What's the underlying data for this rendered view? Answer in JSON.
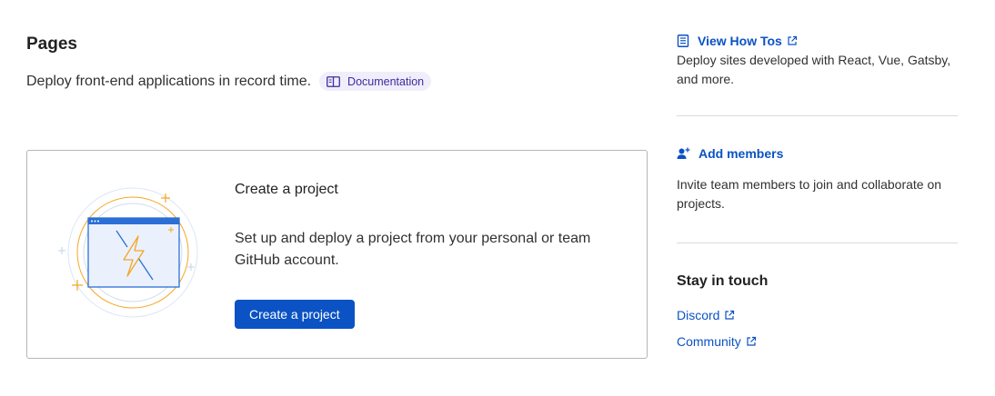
{
  "header": {
    "title": "Pages",
    "subtitle": "Deploy front-end applications in record time.",
    "doc_badge": "Documentation"
  },
  "card": {
    "title": "Create a project",
    "description": "Set up and deploy a project from your personal or team GitHub account.",
    "button": "Create a project"
  },
  "sidebar": {
    "how_tos": {
      "link": "View How Tos",
      "text": "Deploy sites developed with React, Vue, Gatsby, and more."
    },
    "members": {
      "link": "Add members",
      "text": "Invite team members to join and collaborate on projects."
    },
    "stay_in_touch": {
      "title": "Stay in touch",
      "links": [
        "Discord",
        "Community"
      ]
    }
  },
  "colors": {
    "accent": "#0b52c4",
    "badge_bg": "#f0eefb",
    "badge_text": "#3d2c9c",
    "illustration_orange": "#f5a623"
  }
}
